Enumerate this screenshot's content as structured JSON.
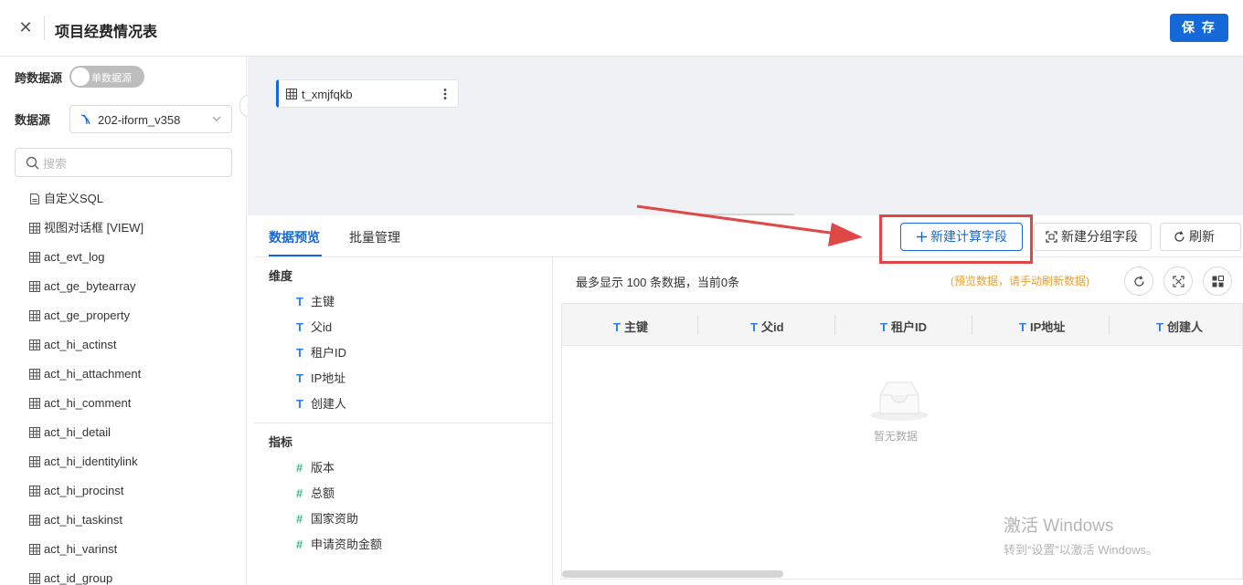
{
  "header": {
    "title": "项目经费情况表",
    "save_label": "保 存"
  },
  "sidebar": {
    "cross_source_label": "跨数据源",
    "toggle_label": "单数据源",
    "datasource_label": "数据源",
    "datasource_value": "202-iform_v358",
    "search_placeholder": "搜索",
    "tables": [
      "自定义SQL",
      "视图对话框 [VIEW]",
      "act_evt_log",
      "act_ge_bytearray",
      "act_ge_property",
      "act_hi_actinst",
      "act_hi_attachment",
      "act_hi_comment",
      "act_hi_detail",
      "act_hi_identitylink",
      "act_hi_procinst",
      "act_hi_taskinst",
      "act_hi_varinst",
      "act_id_group"
    ]
  },
  "canvas": {
    "node_label": "t_xmjfqkb"
  },
  "panel": {
    "tabs": [
      "数据预览",
      "批量管理"
    ],
    "buttons": {
      "new_calc_field": "新建计算字段",
      "new_group_field": "新建分组字段",
      "refresh": "刷新"
    },
    "dimensions_label": "维度",
    "dimensions": [
      "主键",
      "父id",
      "租户ID",
      "IP地址",
      "创建人"
    ],
    "metrics_label": "指标",
    "metrics": [
      "版本",
      "总额",
      "国家资助",
      "申请资助金额"
    ],
    "preview_info": "最多显示 100 条数据，当前0条",
    "preview_hint": "(预览数据，请手动刷新数据)",
    "columns": [
      "主键",
      "父id",
      "租户ID",
      "IP地址",
      "创建人"
    ],
    "empty_text": "暂无数据"
  },
  "watermark": {
    "line1": "激活 Windows",
    "line2": "转到“设置”以激活 Windows。"
  },
  "colors": {
    "primary": "#1468d8",
    "highlight": "#e04848",
    "hint": "#e8a13a"
  }
}
